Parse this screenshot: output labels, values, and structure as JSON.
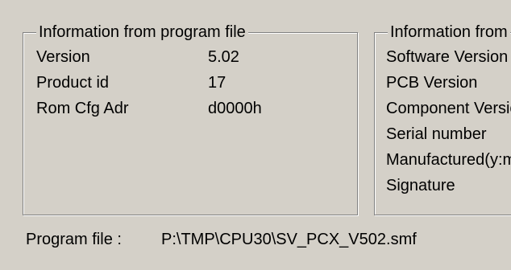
{
  "program_group": {
    "title": "Information from program file",
    "rows": [
      {
        "label": "Version",
        "value": "5.02"
      },
      {
        "label": "Product id",
        "value": "17"
      },
      {
        "label": "Rom Cfg Adr",
        "value": "d0000h"
      }
    ]
  },
  "device_group": {
    "title": "Information from",
    "rows": [
      {
        "label": "Software Version"
      },
      {
        "label": "PCB Version"
      },
      {
        "label": "Component Version"
      },
      {
        "label": "Serial number"
      },
      {
        "label": "Manufactured(y:m)"
      },
      {
        "label": "Signature"
      }
    ]
  },
  "footer": {
    "label": "Program file :",
    "value": "P:\\TMP\\CPU30\\SV_PCX_V502.smf"
  }
}
